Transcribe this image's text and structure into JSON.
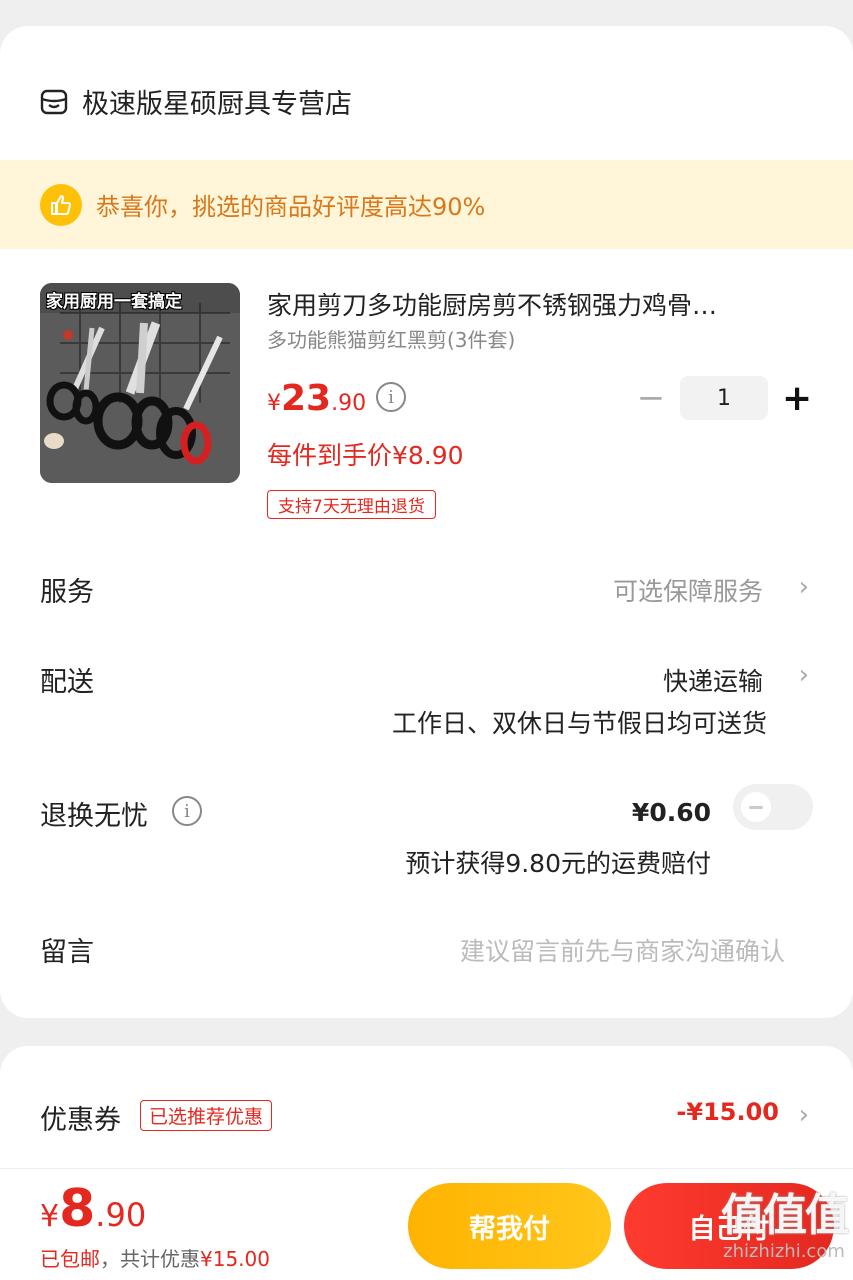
{
  "shop": {
    "icon": "shop-icon",
    "name": "极速版星硕厨具专营店"
  },
  "praise_banner": {
    "icon": "thumbs-up-icon",
    "text": "恭喜你，挑选的商品好评度高达90%"
  },
  "product": {
    "image_caption": "家用厨用一套搞定",
    "title": "家用剪刀多功能厨房剪不锈钢强力鸡骨…",
    "spec": "多功能熊猫剪红黑剪(3件套)",
    "price_symbol": "¥",
    "price_int": "23",
    "price_dec": ".90",
    "unit_price": "每件到手价¥8.90",
    "return_tag": "支持7天无理由退货",
    "quantity": "1",
    "minus_label": "−",
    "plus_label": "+"
  },
  "rows": {
    "service": {
      "label": "服务",
      "value": "可选保障服务",
      "chevron": "›"
    },
    "delivery": {
      "label": "配送",
      "value": "快递运输",
      "note": "工作日、双休日与节假日均可送货",
      "chevron": "›"
    },
    "return_worry_free": {
      "label": "退换无忧",
      "price": "¥0.60",
      "note": "预计获得9.80元的运费赔付",
      "enabled": false
    },
    "message": {
      "label": "留言",
      "placeholder": "建议留言前先与商家沟通确认"
    }
  },
  "coupon": {
    "label": "优惠券",
    "tag": "已选推荐优惠",
    "amount": "-¥15.00",
    "chevron": "›"
  },
  "bottom_bar": {
    "total_symbol": "¥",
    "total_int": "8",
    "total_dec": ".90",
    "free_shipping": "已包邮",
    "discount_prefix": "，共计优惠",
    "discount_amount": "¥15.00",
    "help_pay": "帮我付",
    "submit_pay": "自己付"
  },
  "watermark": {
    "big": "值值值",
    "small": "zhizhizhi.com"
  },
  "colors": {
    "accent": "#e4281f",
    "banner_bg": "#fff5d8",
    "banner_text": "#d9781a",
    "help_button": "#ffb300"
  }
}
